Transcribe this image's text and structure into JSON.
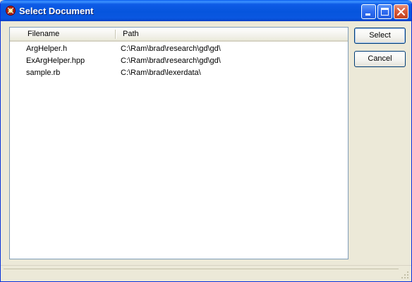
{
  "window": {
    "title": "Select Document",
    "icon": "app-ruby-icon",
    "controls": [
      "minimize-icon",
      "maximize-icon",
      "close-icon"
    ]
  },
  "list": {
    "columns": [
      "Filename",
      "Path"
    ],
    "rows": [
      {
        "filename": "ArgHelper.h",
        "path": "C:\\Ram\\brad\\research\\gd\\gd\\"
      },
      {
        "filename": "ExArgHelper.hpp",
        "path": "C:\\Ram\\brad\\research\\gd\\gd\\"
      },
      {
        "filename": "sample.rb",
        "path": "C:\\Ram\\brad\\lexerdata\\"
      }
    ]
  },
  "buttons": {
    "select": "Select",
    "cancel": "Cancel"
  },
  "colors": {
    "titlebar": "#0655dd",
    "close_button": "#d85a3a",
    "face": "#ece9d8",
    "list_border": "#7f9db9"
  }
}
